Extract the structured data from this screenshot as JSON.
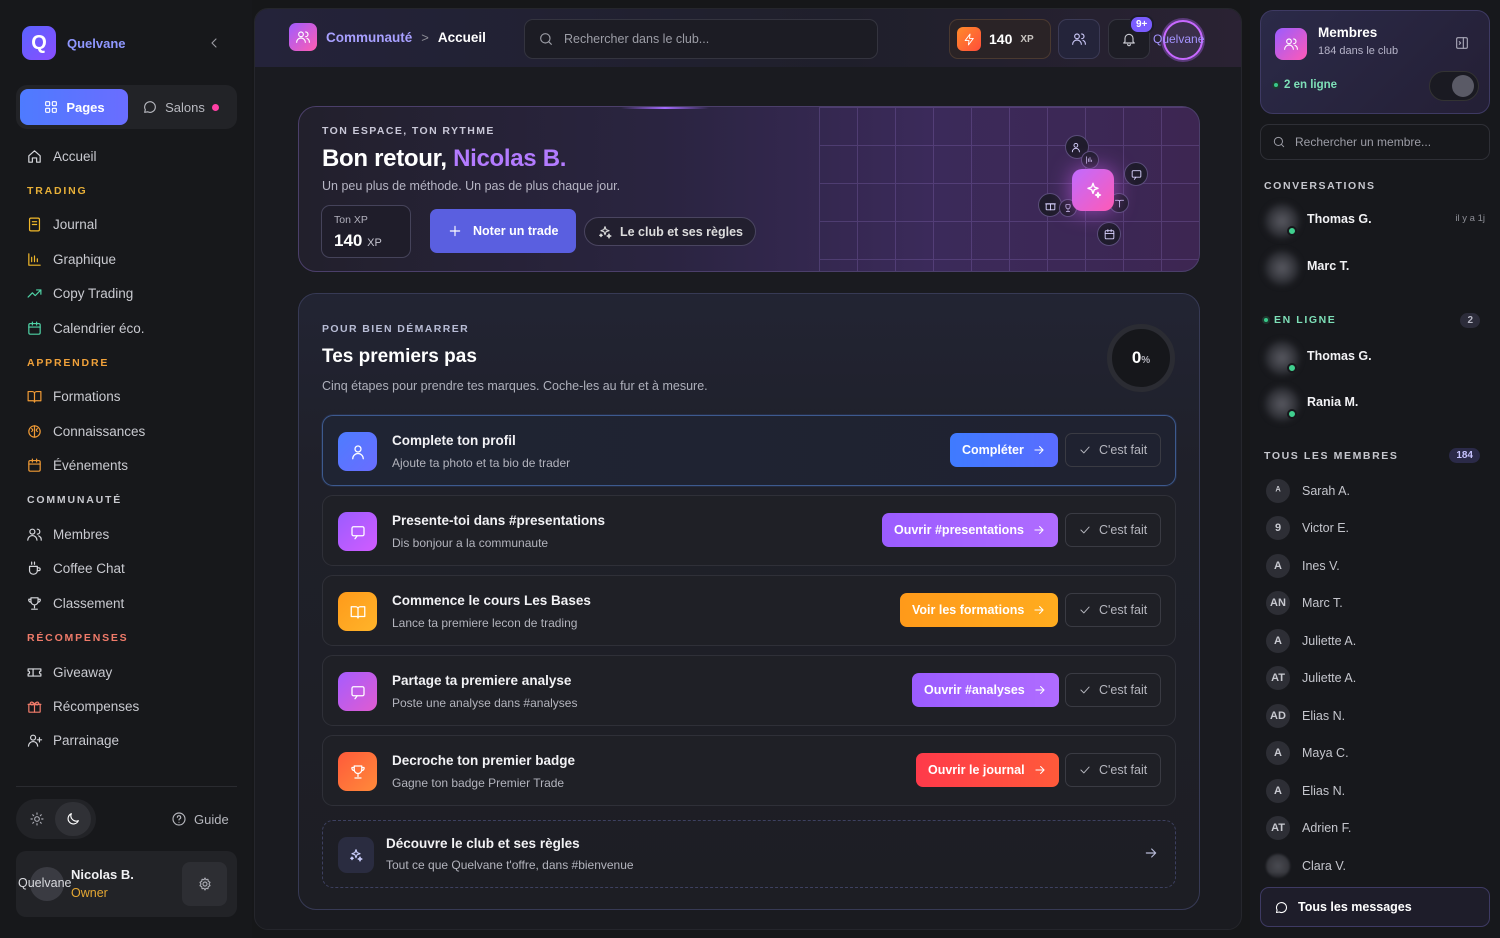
{
  "sidebar": {
    "brand": "Quelvane",
    "tabs": {
      "pages": "Pages",
      "salons": "Salons"
    },
    "home": "Accueil",
    "sections": [
      {
        "title": "TRADING",
        "items": [
          "Journal",
          "Graphique",
          "Copy Trading",
          "Calendrier éco."
        ]
      },
      {
        "title": "APPRENDRE",
        "items": [
          "Formations",
          "Connaissances",
          "Événements"
        ]
      },
      {
        "title": "COMMUNAUTÉ",
        "items": [
          "Membres",
          "Coffee Chat",
          "Classement"
        ]
      },
      {
        "title": "RÉCOMPENSES",
        "items": [
          "Giveaway",
          "Récompenses",
          "Parrainage"
        ]
      }
    ],
    "guide": "Guide",
    "user": {
      "avatar_alt": "Quelvane",
      "name": "Nicolas B.",
      "role": "Owner"
    }
  },
  "topbar": {
    "crumb_parent": "Communauté",
    "crumb_sep": ">",
    "crumb_current": "Accueil",
    "search_placeholder": "Rechercher dans le club...",
    "xp_value": "140",
    "xp_unit": "XP",
    "notif_badge": "9+",
    "avatar_alt": "Quelvane"
  },
  "hero": {
    "kicker": "TON ESPACE, TON RYTHME",
    "greeting": "Bon retour, ",
    "name": "Nicolas B.",
    "subtitle": "Un peu plus de méthode. Un pas de plus chaque jour.",
    "xp_label": "Ton XP",
    "xp_value": "140",
    "xp_unit": "XP",
    "primary_btn": "Noter un trade",
    "secondary_btn": "Le club et ses règles"
  },
  "steps": {
    "kicker": "POUR BIEN DÉMARRER",
    "title": "Tes premiers pas",
    "subtitle": "Cinq étapes pour prendre tes marques. Coche-les au fur et à mesure.",
    "progress_value": "0",
    "progress_unit": "%",
    "done_label": "C'est fait",
    "items": [
      {
        "title": "Complete ton profil",
        "desc": "Ajoute ta photo et ta bio de trader",
        "cta": "Compléter",
        "color": "#4d7cff"
      },
      {
        "title": "Presente-toi dans #presentations",
        "desc": "Dis bonjour a la communaute",
        "cta": "Ouvrir #presentations",
        "color": "#9b5cff"
      },
      {
        "title": "Commence le cours Les Bases",
        "desc": "Lance ta premiere lecon de trading",
        "cta": "Voir les formations",
        "color": "#ff9a1a"
      },
      {
        "title": "Partage ta premiere analyse",
        "desc": "Poste une analyse dans #analyses",
        "cta": "Ouvrir #analyses",
        "color": "#a55cff"
      },
      {
        "title": "Decroche ton premier badge",
        "desc": "Gagne ton badge Premier Trade",
        "cta": "Ouvrir le journal",
        "color": "#ff4f3a"
      }
    ],
    "discover": {
      "title": "Découvre le club et ses règles",
      "desc": "Tout ce que Quelvane t'offre, dans #bienvenue"
    }
  },
  "right": {
    "members_title": "Membres",
    "members_sub": "184 dans le club",
    "online_label": "2 en ligne",
    "search_placeholder": "Rechercher un membre...",
    "conversations_title": "CONVERSATIONS",
    "conversations": [
      {
        "name": "Thomas G.",
        "time": "il y a 1j"
      },
      {
        "name": "Marc T.",
        "time": ""
      }
    ],
    "online_title": "EN LIGNE",
    "online_count": "2",
    "online": [
      "Thomas G.",
      "Rania M."
    ],
    "all_title": "TOUS LES MEMBRES",
    "all_count": "184",
    "members": [
      {
        "initials": "ᴬ",
        "name": "Sarah A."
      },
      {
        "initials": "9",
        "name": "Victor E."
      },
      {
        "initials": "A",
        "name": "Ines V."
      },
      {
        "initials": "AN",
        "name": "Marc T."
      },
      {
        "initials": "A",
        "name": "Juliette A."
      },
      {
        "initials": "AT",
        "name": "Juliette A."
      },
      {
        "initials": "AD",
        "name": "Elias N."
      },
      {
        "initials": "A",
        "name": "Maya C."
      },
      {
        "initials": "A",
        "name": "Elias N."
      },
      {
        "initials": "AT",
        "name": "Adrien F."
      },
      {
        "initials": "",
        "name": "Clara V."
      }
    ],
    "all_messages": "Tous les messages"
  }
}
